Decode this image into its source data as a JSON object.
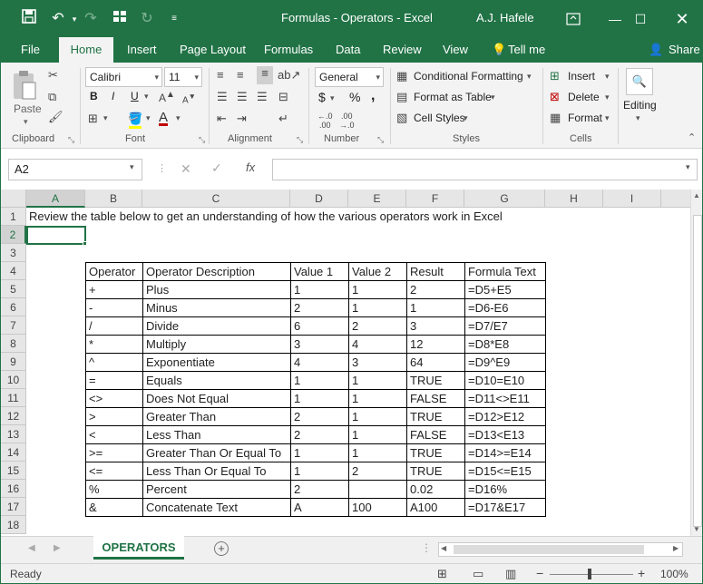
{
  "title_bar": {
    "title": "Formulas - Operators  -  Excel",
    "user": "A.J. Hafele"
  },
  "ribbon_tabs": [
    "File",
    "Home",
    "Insert",
    "Page Layout",
    "Formulas",
    "Data",
    "Review",
    "View",
    "Tell me",
    "Share"
  ],
  "ribbon": {
    "clipboard": {
      "paste": "Paste",
      "label": "Clipboard"
    },
    "font": {
      "name": "Calibri",
      "size": "11",
      "bold": "B",
      "italic": "I",
      "underline": "U",
      "label": "Font"
    },
    "alignment": {
      "label": "Alignment"
    },
    "number": {
      "format": "General",
      "currency": "$",
      "percent": "%",
      "comma": ",",
      "label": "Number"
    },
    "styles": {
      "conditional": "Conditional Formatting",
      "format_table": "Format as Table",
      "cell_styles": "Cell Styles",
      "label": "Styles"
    },
    "cells": {
      "insert": "Insert",
      "delete": "Delete",
      "format": "Format",
      "label": "Cells"
    },
    "editing": {
      "label": "Editing"
    }
  },
  "formula_bar": {
    "name_box": "A2",
    "formula": ""
  },
  "columns": [
    "A",
    "B",
    "C",
    "D",
    "E",
    "F",
    "G",
    "H",
    "I"
  ],
  "rows": [
    "1",
    "2",
    "3",
    "4",
    "5",
    "6",
    "7",
    "8",
    "9",
    "10",
    "11",
    "12",
    "13",
    "14",
    "15",
    "16",
    "17",
    "18"
  ],
  "note": "Review the table below to get an understanding of how the various operators work in Excel",
  "table": {
    "headers": [
      "Operator",
      "Operator Description",
      "Value 1",
      "Value 2",
      "Result",
      "Formula Text"
    ],
    "rows": [
      [
        "+",
        "Plus",
        "1",
        "1",
        "2",
        "=D5+E5"
      ],
      [
        "-",
        "Minus",
        "2",
        "1",
        "1",
        "=D6-E6"
      ],
      [
        "/",
        "Divide",
        "6",
        "2",
        "3",
        "=D7/E7"
      ],
      [
        "*",
        "Multiply",
        "3",
        "4",
        "12",
        "=D8*E8"
      ],
      [
        "^",
        "Exponentiate",
        "4",
        "3",
        "64",
        "=D9^E9"
      ],
      [
        "=",
        "Equals",
        "1",
        "1",
        "TRUE",
        "=D10=E10"
      ],
      [
        "<>",
        "Does Not Equal",
        "1",
        "1",
        "FALSE",
        "=D11<>E11"
      ],
      [
        ">",
        "Greater Than",
        "2",
        "1",
        "TRUE",
        "=D12>E12"
      ],
      [
        "<",
        "Less Than",
        "2",
        "1",
        "FALSE",
        "=D13<E13"
      ],
      [
        ">=",
        "Greater Than Or Equal To",
        "1",
        "1",
        "TRUE",
        "=D14>=E14"
      ],
      [
        "<=",
        "Less Than Or Equal To",
        "1",
        "2",
        "TRUE",
        "=D15<=E15"
      ],
      [
        "%",
        "Percent",
        "2",
        "",
        "0.02",
        "=D16%"
      ],
      [
        "&",
        "Concatenate Text",
        "A",
        "100",
        "A100",
        "=D17&E17"
      ]
    ]
  },
  "sheet_tab": "OPERATORS",
  "status": {
    "text": "Ready",
    "zoom": "100%"
  },
  "colors": {
    "accent": "#217346"
  }
}
